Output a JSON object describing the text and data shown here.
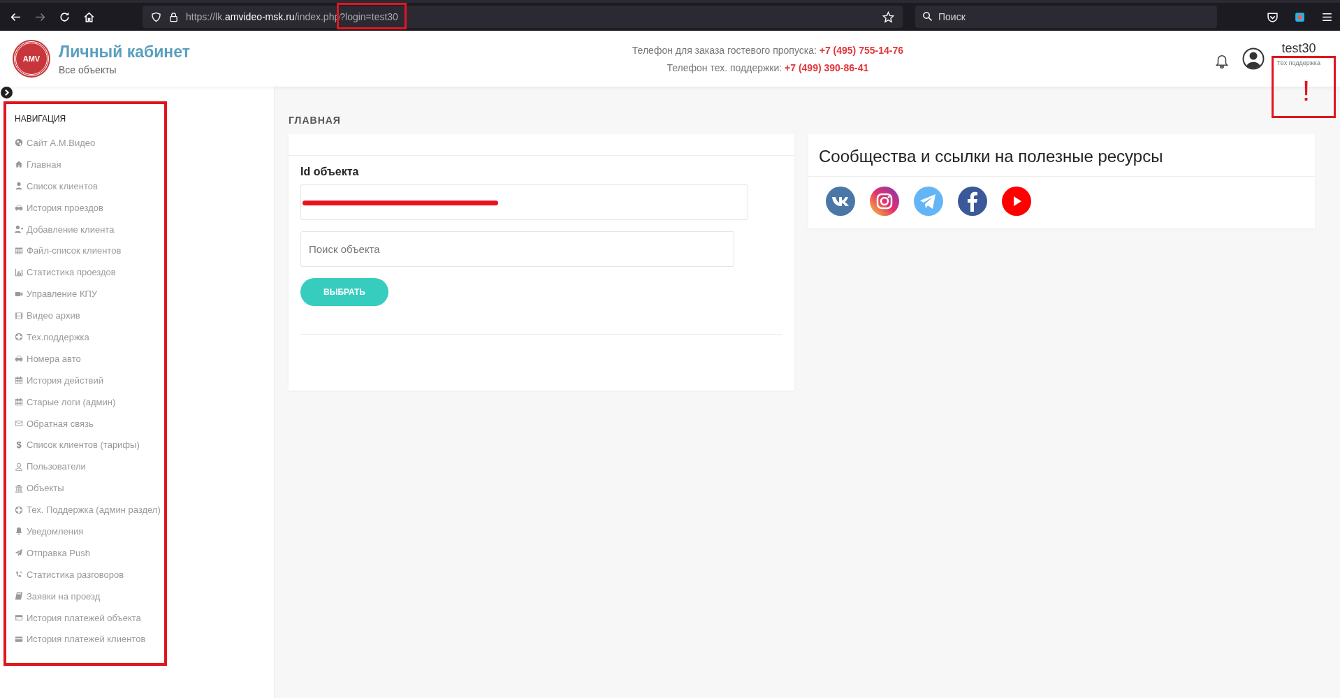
{
  "browser": {
    "url": "https://lk.**amvideo-msk.ru**/index.php?login=test30",
    "search": {
      "placeholder": "Поиск"
    }
  },
  "header": {
    "logo_text": "AMV",
    "title": "Личный кабинет",
    "subtitle": "Все объекты",
    "phones": [
      "Телефон для заказа гостевого пропуска: **+7 (495) 755-14-76**",
      "Телефон тех. поддержки: **+7 (499) 390-86-41**"
    ],
    "user": {
      "name": "test30",
      "role": "Тех поддержка"
    },
    "annotation_mark": "!"
  },
  "sidebar": {
    "heading": "НАВИГАЦИЯ",
    "items": [
      {
        "label": "Сайт А.М.Видео"
      },
      {
        "label": "Главная"
      },
      {
        "label": "Список клиентов"
      },
      {
        "label": "История проездов"
      },
      {
        "label": "Добавление клиента"
      },
      {
        "label": "Файл-список клиентов"
      },
      {
        "label": "Статистика проездов"
      },
      {
        "label": "Управление КПУ"
      },
      {
        "label": "Видео архив"
      },
      {
        "label": "Тех.поддержка"
      },
      {
        "label": "Номера авто"
      },
      {
        "label": "История действий"
      },
      {
        "label": "Старые логи (админ)"
      },
      {
        "label": "Обратная связь"
      },
      {
        "label": "Список клиентов (тарифы)",
        "icon_text": "$"
      },
      {
        "label": "Пользователи"
      },
      {
        "label": "Объекты"
      },
      {
        "label": "Тех. Поддержка (админ раздел)"
      },
      {
        "label": "Уведомления"
      },
      {
        "label": "Отправка Push"
      },
      {
        "label": "Статистика разговоров"
      },
      {
        "label": "Заявки на проезд"
      },
      {
        "label": "История платежей объекта"
      },
      {
        "label": "История платежей клиентов"
      }
    ]
  },
  "page_title": "ГЛАВНАЯ",
  "object_card": {
    "label": "Id объекта",
    "search": {
      "placeholder": "Поиск объекта"
    },
    "button": "ВЫБРАТЬ"
  },
  "links_card": {
    "title": "Сообщества и ссылки на полезные ресурсы"
  }
}
